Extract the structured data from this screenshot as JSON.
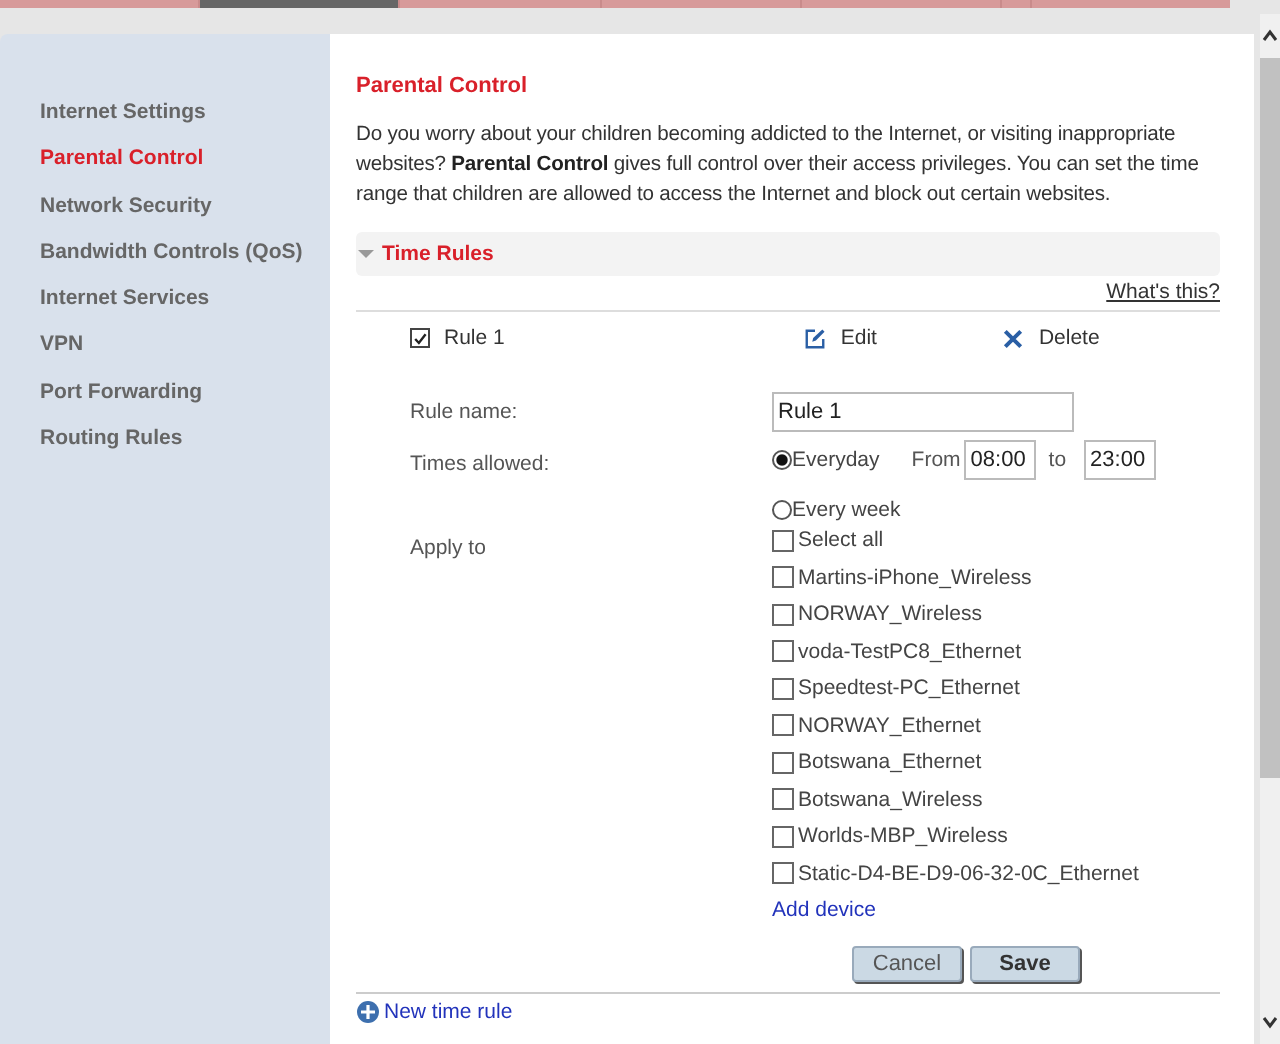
{
  "sidebar": {
    "items": [
      {
        "label": "Internet Settings",
        "selected": false
      },
      {
        "label": "Parental Control",
        "selected": true
      },
      {
        "label": "Network Security",
        "selected": false
      },
      {
        "label": "Bandwidth Controls (QoS)",
        "selected": false
      },
      {
        "label": "Internet Services",
        "selected": false
      },
      {
        "label": "VPN",
        "selected": false
      },
      {
        "label": "Port Forwarding",
        "selected": false
      },
      {
        "label": "Routing Rules",
        "selected": false
      }
    ]
  },
  "page": {
    "title": "Parental Control",
    "description": "Do you worry about your children becoming addicted to the Internet, or visiting inappropriate websites? **Parental Control** gives full control over their access privileges. You can set the time range that children are allowed to access the Internet and block out certain websites."
  },
  "section": {
    "title": "Time Rules",
    "expanded": true,
    "help_link": "What's this?",
    "rule": {
      "name": "Rule 1",
      "checked": true,
      "edit": "Edit",
      "delete": "Delete"
    },
    "form": {
      "rule_name_label": "Rule name:",
      "rule_name_value": "Rule 1",
      "times_label": "Times allowed:",
      "schedule": [
        {
          "label": "Everyday",
          "selected": true
        },
        {
          "label": "Every week",
          "selected": false
        }
      ],
      "from_label": "From",
      "from_value": "08:00",
      "to_label": "to",
      "to_value": "23:00",
      "apply_label": "Apply to",
      "devices": [
        {
          "label": "Select all",
          "checked": false
        },
        {
          "label": "Martins-iPhone_Wireless",
          "checked": false
        },
        {
          "label": "NORWAY_Wireless",
          "checked": false
        },
        {
          "label": "voda-TestPC8_Ethernet",
          "checked": false
        },
        {
          "label": "Speedtest-PC_Ethernet",
          "checked": false
        },
        {
          "label": "NORWAY_Ethernet",
          "checked": false
        },
        {
          "label": "Botswana_Ethernet",
          "checked": false
        },
        {
          "label": "Botswana_Wireless",
          "checked": false
        },
        {
          "label": "Worlds-MBP_Wireless",
          "checked": false
        },
        {
          "label": "Static-D4-BE-D9-06-32-0C_Ethernet",
          "checked": false
        }
      ],
      "add_device": "Add device"
    },
    "buttons": [
      "Cancel",
      "Save"
    ],
    "new_rule": "New time rule"
  }
}
